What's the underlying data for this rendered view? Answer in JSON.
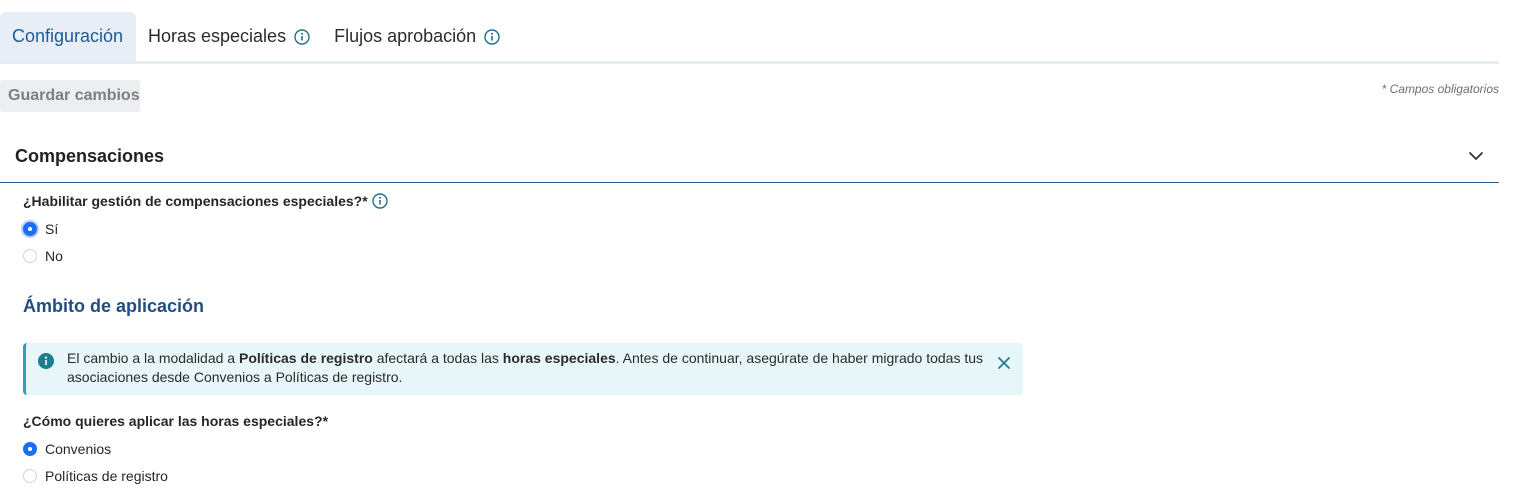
{
  "tabs": [
    {
      "label": "Configuración",
      "active": true,
      "info": false
    },
    {
      "label": "Horas especiales",
      "active": false,
      "info": true
    },
    {
      "label": "Flujos aprobación",
      "active": false,
      "info": true
    }
  ],
  "toolbar": {
    "save_label": "Guardar cambios",
    "required_note": "* Campos obligatorios"
  },
  "section": {
    "title": "Compensaciones"
  },
  "question1": {
    "label": "¿Habilitar gestión de compensaciones especiales?*",
    "options": [
      {
        "label": "Sí",
        "checked": true
      },
      {
        "label": "No",
        "checked": false
      }
    ]
  },
  "scope": {
    "heading": "Ámbito de aplicación"
  },
  "alert": {
    "text_1": "El cambio a la modalidad a ",
    "bold_1": "Políticas de registro",
    "text_2": " afectará a todas las ",
    "bold_2": "horas especiales",
    "text_3": ". Antes de continuar, asegúrate de haber migrado todas tus asociaciones desde Convenios a Políticas de registro."
  },
  "question2": {
    "label": "¿Cómo quieres aplicar las horas especiales?*",
    "options": [
      {
        "label": "Convenios",
        "checked": true
      },
      {
        "label": "Políticas de registro",
        "checked": false
      }
    ]
  },
  "colors": {
    "accent": "#1f5b95",
    "radio_checked": "#1b6ef3",
    "alert_bg": "#e7f6f8",
    "alert_border": "#2aa3b3"
  }
}
